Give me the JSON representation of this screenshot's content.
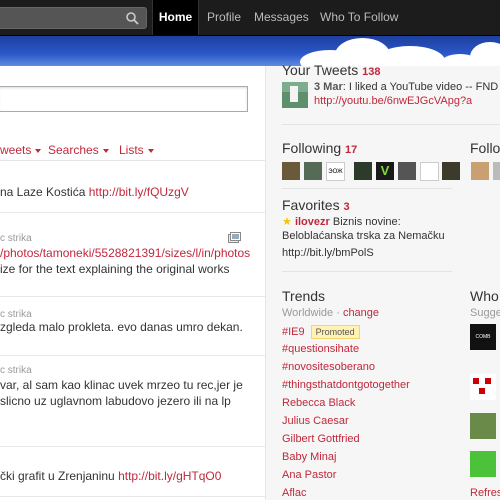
{
  "topbar": {
    "search_placeholder": "",
    "nav": [
      {
        "label": "Home"
      },
      {
        "label": "Profile"
      },
      {
        "label": "Messages"
      },
      {
        "label": "Who To Follow"
      }
    ]
  },
  "main": {
    "tabs": [
      {
        "label": "weets"
      },
      {
        "label": "Searches"
      },
      {
        "label": "Lists"
      }
    ],
    "tweets": [
      {
        "text": "na Laze Kostića ",
        "link": "http://bit.ly/fQUzgV"
      },
      {
        "meta": "c strika",
        "link": "/photos/tamoneki/5528821391/sizes/l/in/photos",
        "text": "ize for the text explaining the original works"
      },
      {
        "meta": "c strika",
        "text": "zgleda malo prokleta. evo danas umro dekan."
      },
      {
        "meta": "c strika",
        "line1": "var, al sam kao klinac uvek mrzeo tu rec,jer je",
        "line2": "slicno uz uglavnom labudovo jezero ili na lp"
      },
      {
        "text": "čki grafit u Zrenjaninu ",
        "link": "http://bit.ly/gHTqO0"
      }
    ]
  },
  "dashboard": {
    "your_tweets": {
      "title": "Your Tweets",
      "count": "138",
      "date": "3 Mar",
      "text": ": I liked a YouTube video -- FND F",
      "link": "http://youtu.be/6nwEJGcVApg?a"
    },
    "following": {
      "title": "Following",
      "count": "17"
    },
    "followers_partial": "Follo",
    "favorites": {
      "title": "Favorites",
      "count": "3",
      "user": "ilovezr",
      "text1": " Biznis novine:",
      "text2": "Beloblaćanska trska za Nemačku",
      "text3": "http://bit.ly/bmPolS"
    },
    "trends": {
      "title": "Trends",
      "location": "Worldwide",
      "change": "change",
      "promoted_label": "Promoted",
      "items": [
        "#IE9",
        "#questionsihate",
        "#novositesoberano",
        "#thingsthatdontgotogether",
        "Rebecca Black",
        "Julius Caesar",
        "Gilbert Gottfried",
        "Baby Minaj",
        "Ana Pastor",
        "Aflac"
      ]
    },
    "who_to_follow": {
      "title": "Who t",
      "suggest": "Sugge",
      "refresh": "Refres"
    }
  },
  "colors": {
    "accent": "#c0283c",
    "topbar": "#1c1c1c",
    "dashboard_bg": "#f6f6f6"
  }
}
